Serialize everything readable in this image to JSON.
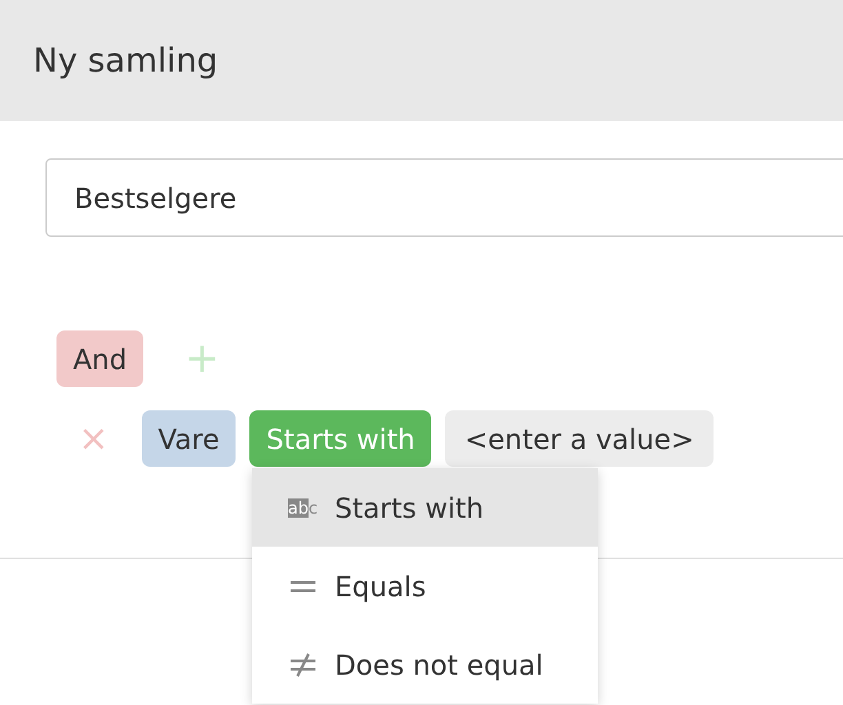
{
  "header": {
    "title": "Ny samling"
  },
  "name_field": {
    "value": "Bestselgere"
  },
  "group": {
    "operator": "And",
    "add": "+"
  },
  "condition": {
    "remove": "×",
    "field": "Vare",
    "operator": "Starts with",
    "value": "<enter a value>"
  },
  "dropdown": {
    "options": [
      {
        "kind": "starts",
        "label": "Starts with",
        "selected": true,
        "icon_text": [
          "ab",
          "c"
        ]
      },
      {
        "kind": "equals",
        "label": "Equals",
        "selected": false
      },
      {
        "kind": "notequal",
        "label": "Does not equal",
        "selected": false
      }
    ]
  }
}
